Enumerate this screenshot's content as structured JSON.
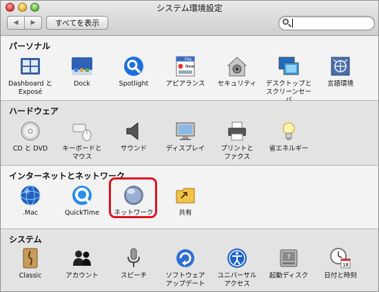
{
  "window": {
    "title": "システム環境設定",
    "back_button": "◀",
    "forward_button": "▶",
    "show_all_label": "すべてを表示",
    "search": {
      "value": "",
      "placeholder": ""
    }
  },
  "sections": [
    {
      "title": "パーソナル",
      "items": [
        {
          "label": "Dashboard と\nExposé",
          "icon": "dashboard-expose-icon"
        },
        {
          "label": "Dock",
          "icon": "dock-icon"
        },
        {
          "label": "Spotlight",
          "icon": "spotlight-icon"
        },
        {
          "label": "アピアランス",
          "icon": "appearance-icon"
        },
        {
          "label": "セキュリティ",
          "icon": "security-icon"
        },
        {
          "label": "デスクトップと\nスクリーンセーバ",
          "icon": "desktop-screensaver-icon"
        },
        {
          "label": "言語環境",
          "icon": "international-icon"
        }
      ]
    },
    {
      "title": "ハードウェア",
      "items": [
        {
          "label": "CD と DVD",
          "icon": "cd-dvd-icon"
        },
        {
          "label": "キーボードと\nマウス",
          "icon": "keyboard-mouse-icon"
        },
        {
          "label": "サウンド",
          "icon": "sound-icon"
        },
        {
          "label": "ディスプレイ",
          "icon": "display-icon"
        },
        {
          "label": "プリントと\nファクス",
          "icon": "print-fax-icon"
        },
        {
          "label": "省エネルギー",
          "icon": "energy-saver-icon"
        }
      ]
    },
    {
      "title": "インターネットとネットワーク",
      "items": [
        {
          "label": ".Mac",
          "icon": "dotmac-icon"
        },
        {
          "label": "QuickTime",
          "icon": "quicktime-icon"
        },
        {
          "label": "ネットワーク",
          "icon": "network-icon",
          "highlighted": true
        },
        {
          "label": "共有",
          "icon": "sharing-icon"
        }
      ]
    },
    {
      "title": "システム",
      "items": [
        {
          "label": "Classic",
          "icon": "classic-icon"
        },
        {
          "label": "アカウント",
          "icon": "accounts-icon"
        },
        {
          "label": "スピーチ",
          "icon": "speech-icon"
        },
        {
          "label": "ソフトウェア\nアップデート",
          "icon": "software-update-icon"
        },
        {
          "label": "ユニバーサル\nアクセス",
          "icon": "universal-access-icon"
        },
        {
          "label": "起動ディスク",
          "icon": "startup-disk-icon"
        },
        {
          "label": "日付と時刻",
          "icon": "date-time-icon"
        }
      ]
    }
  ],
  "colors": {
    "highlight": "#e0101b",
    "section_odd": "#f3f3f3",
    "section_even": "#e3e3e3"
  },
  "icon_text": {
    "appearance": [
      "File",
      "New"
    ],
    "calendar_day": "18"
  }
}
